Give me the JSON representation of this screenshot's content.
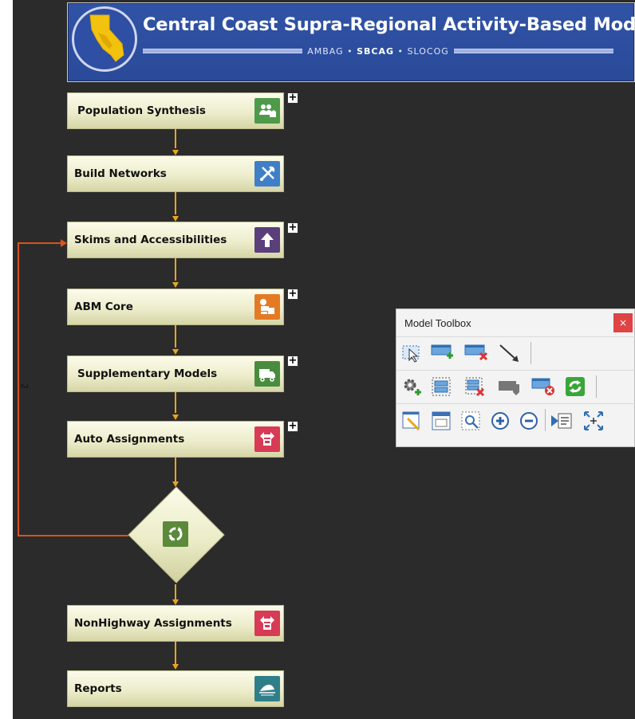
{
  "banner": {
    "title": "Central Coast Supra-Regional Activity-Based Model",
    "sub_ambag": "AMBAG",
    "sub_sbcag": "SBCAG",
    "sub_slocog": "SLOCOG",
    "sub_sep": "•"
  },
  "steps": [
    {
      "label": "Population Synthesis",
      "icon": "population-icon",
      "color": "#4f9a4a",
      "expandable": true
    },
    {
      "label": "Build Networks",
      "icon": "tools-icon",
      "color": "#3f7fc7",
      "expandable": false
    },
    {
      "label": "Skims and Accessibilities",
      "icon": "up-arrow-icon",
      "color": "#5a3f7a",
      "expandable": true
    },
    {
      "label": "ABM Core",
      "icon": "activity-icon",
      "color": "#e47b24",
      "expandable": true
    },
    {
      "label": "Supplementary Models",
      "icon": "truck-icon",
      "color": "#4a8c3f",
      "expandable": true
    },
    {
      "label": "Auto Assignments",
      "icon": "assignment-icon",
      "color": "#d73b55",
      "expandable": true
    },
    {
      "label": "NonHighway Assignments",
      "icon": "assignment-icon",
      "color": "#d73b55",
      "expandable": false
    },
    {
      "label": "Reports",
      "icon": "report-icon",
      "color": "#2f7f8a",
      "expandable": false
    }
  ],
  "loop": {
    "icon": "recycle-icon",
    "color": "#5a8a3a",
    "feedback_label": "2"
  },
  "expand_symbol": "+",
  "toolbox": {
    "title": "Model Toolbox",
    "close_symbol": "×"
  },
  "colors": {
    "canvas": "#2b2b2b",
    "connector": "#e8a620",
    "feedback": "#d9531e",
    "banner": "#2e4fa2"
  }
}
